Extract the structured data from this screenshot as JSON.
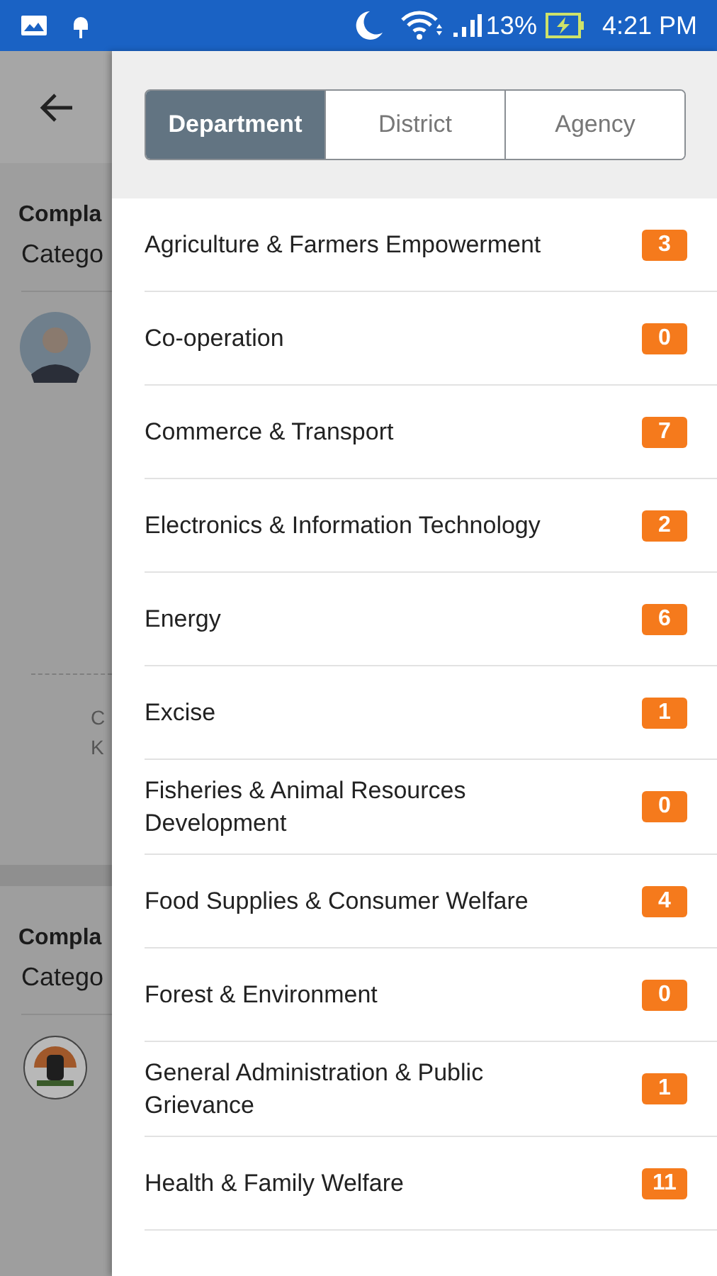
{
  "status_bar": {
    "battery": "13%",
    "time": "4:21 PM"
  },
  "background": {
    "cards": [
      {
        "title": "Compla",
        "category": "Catego",
        "kind": "person",
        "footer": [
          "C",
          "K"
        ]
      },
      {
        "title": "Compla",
        "category": "Catego",
        "kind": "logo"
      }
    ]
  },
  "tabs": [
    {
      "label": "Department",
      "selected": true
    },
    {
      "label": "District",
      "selected": false
    },
    {
      "label": "Agency",
      "selected": false
    }
  ],
  "items": [
    {
      "name": "Agriculture & Farmers Empowerment",
      "count": "3"
    },
    {
      "name": "Co-operation",
      "count": "0"
    },
    {
      "name": "Commerce & Transport",
      "count": "7"
    },
    {
      "name": "Electronics & Information Technology",
      "count": "2"
    },
    {
      "name": "Energy",
      "count": "6"
    },
    {
      "name": "Excise",
      "count": "1"
    },
    {
      "name": "Fisheries & Animal Resources Development",
      "count": "0"
    },
    {
      "name": "Food Supplies & Consumer Welfare",
      "count": "4"
    },
    {
      "name": "Forest & Environment",
      "count": "0"
    },
    {
      "name": "General Administration & Public Grievance",
      "count": "1"
    },
    {
      "name": "Health & Family Welfare",
      "count": "11"
    }
  ]
}
